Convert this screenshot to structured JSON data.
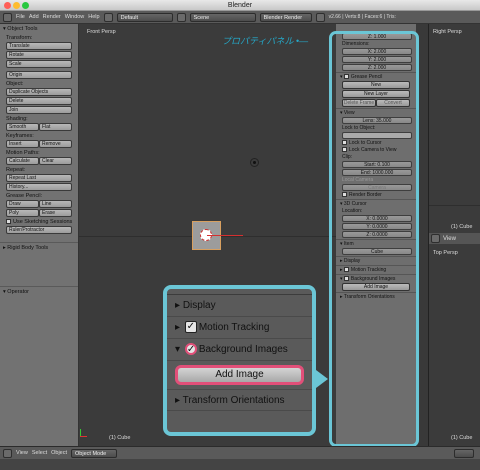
{
  "window": {
    "title": "Blender"
  },
  "infobar": {
    "menus": [
      "File",
      "Add",
      "Render",
      "Window",
      "Help"
    ],
    "layout": "Default",
    "scene": "Scene",
    "engine": "Blender Render",
    "stats": "v2.66 | Verts:8 | Faces:6 | Tris:"
  },
  "toolshelf": {
    "header": "Object Tools",
    "transform_label": "Transform:",
    "translate": "Translate",
    "rotate": "Rotate",
    "scale": "Scale",
    "origin": "Origin",
    "object_label": "Object:",
    "duplicate": "Duplicate Objects",
    "delete": "Delete",
    "join": "Join",
    "shading_label": "Shading:",
    "smooth": "Smooth",
    "flat": "Flat",
    "keyframes_label": "Keyframes:",
    "insert": "Insert",
    "remove": "Remove",
    "motion_label": "Motion Paths:",
    "calculate": "Calculate",
    "clear": "Clear",
    "repeat_label": "Repeat:",
    "repeat_last": "Repeat Last",
    "history": "History...",
    "grease_label": "Grease Pencil:",
    "draw": "Draw",
    "line": "Line",
    "poly": "Poly",
    "erase": "Erase",
    "sketching": "Use Sketching Sessions",
    "ruler": "Ruler/Protractor",
    "rigid_header": "Rigid Body Tools",
    "operator_header": "Operator"
  },
  "viewport": {
    "label": "Front Persp",
    "object_label": "(1) Cube"
  },
  "annotation": {
    "text": "プロパティパネル"
  },
  "props": {
    "z_top": "Z: 1.000",
    "dimensions_label": "Dimensions:",
    "dx": "X: 2.000",
    "dy": "Y: 2.000",
    "dz": "Z: 2.000",
    "grease_header": "Grease Pencil",
    "new": "New",
    "new_layer": "New Layer",
    "delete_frame": "Delete Frame",
    "convert": "Convert",
    "view_header": "View",
    "lens": "Lens: 35.000",
    "lock_obj_label": "Lock to Object:",
    "lock_cursor": "Lock to Cursor",
    "lock_camera": "Lock Camera to View",
    "clip_label": "Clip:",
    "start": "Start: 0.100",
    "end": "End: 1000.000",
    "local_camera": "Local Camera",
    "camera": "Camera",
    "render_border": "Render Border",
    "cursor_header": "3D Cursor",
    "location_label": "Location:",
    "cx": "X: 0.0000",
    "cy": "Y: 0.0000",
    "cz": "Z: 0.0000",
    "item_header": "Item",
    "item_name": "Cube",
    "display": "Display",
    "motion_tracking": "Motion Tracking",
    "background_images": "Background Images",
    "add_image": "Add Image",
    "transform_orient": "Transform Orientations"
  },
  "rightpanel": {
    "label_top": "Right Persp",
    "cube1": "(1) Cube",
    "view1": "View",
    "label_mid": "Top Persp",
    "cube2": "(1) Cube",
    "view2": "View"
  },
  "bottombar": {
    "view": "View",
    "select": "Select",
    "object": "Object",
    "mode": "Object Mode"
  },
  "zoom": {
    "display": "Display",
    "motion_tracking": "Motion Tracking",
    "background_images": "Background Images",
    "add_image": "Add Image",
    "transform_orient": "Transform Orientations"
  }
}
